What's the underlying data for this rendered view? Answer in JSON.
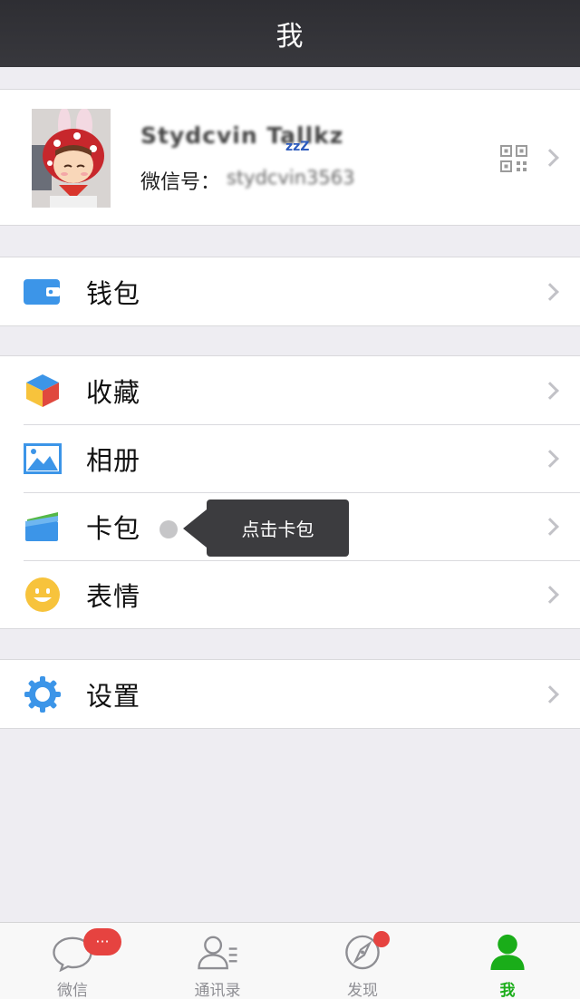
{
  "nav": {
    "title": "我"
  },
  "profile": {
    "nickname": "Stydcvin Tallkz",
    "zzz": "zzZ",
    "wechat_id_label": "微信号：",
    "wechat_id_value": "stydcvin3563",
    "icon": "qr-code-icon"
  },
  "menu": {
    "wallet": {
      "label": "钱包",
      "icon": "wallet-icon"
    },
    "favorites": {
      "label": "收藏",
      "icon": "cube-icon"
    },
    "album": {
      "label": "相册",
      "icon": "photo-icon"
    },
    "cards": {
      "label": "卡包",
      "icon": "card-icon"
    },
    "stickers": {
      "label": "表情",
      "icon": "smiley-icon"
    },
    "settings": {
      "label": "设置",
      "icon": "gear-icon"
    }
  },
  "tooltip": {
    "text": "点击卡包"
  },
  "tabbar": {
    "chats": {
      "label": "微信",
      "badge": "···",
      "icon": "chat-bubble-icon"
    },
    "contacts": {
      "label": "通讯录",
      "icon": "contacts-icon"
    },
    "discover": {
      "label": "发现",
      "icon": "compass-icon"
    },
    "me": {
      "label": "我",
      "icon": "person-icon"
    }
  },
  "colors": {
    "accent_green": "#1aad19",
    "badge_red": "#e64340",
    "nav_bg": "#333338",
    "page_bg": "#eeedf2"
  }
}
